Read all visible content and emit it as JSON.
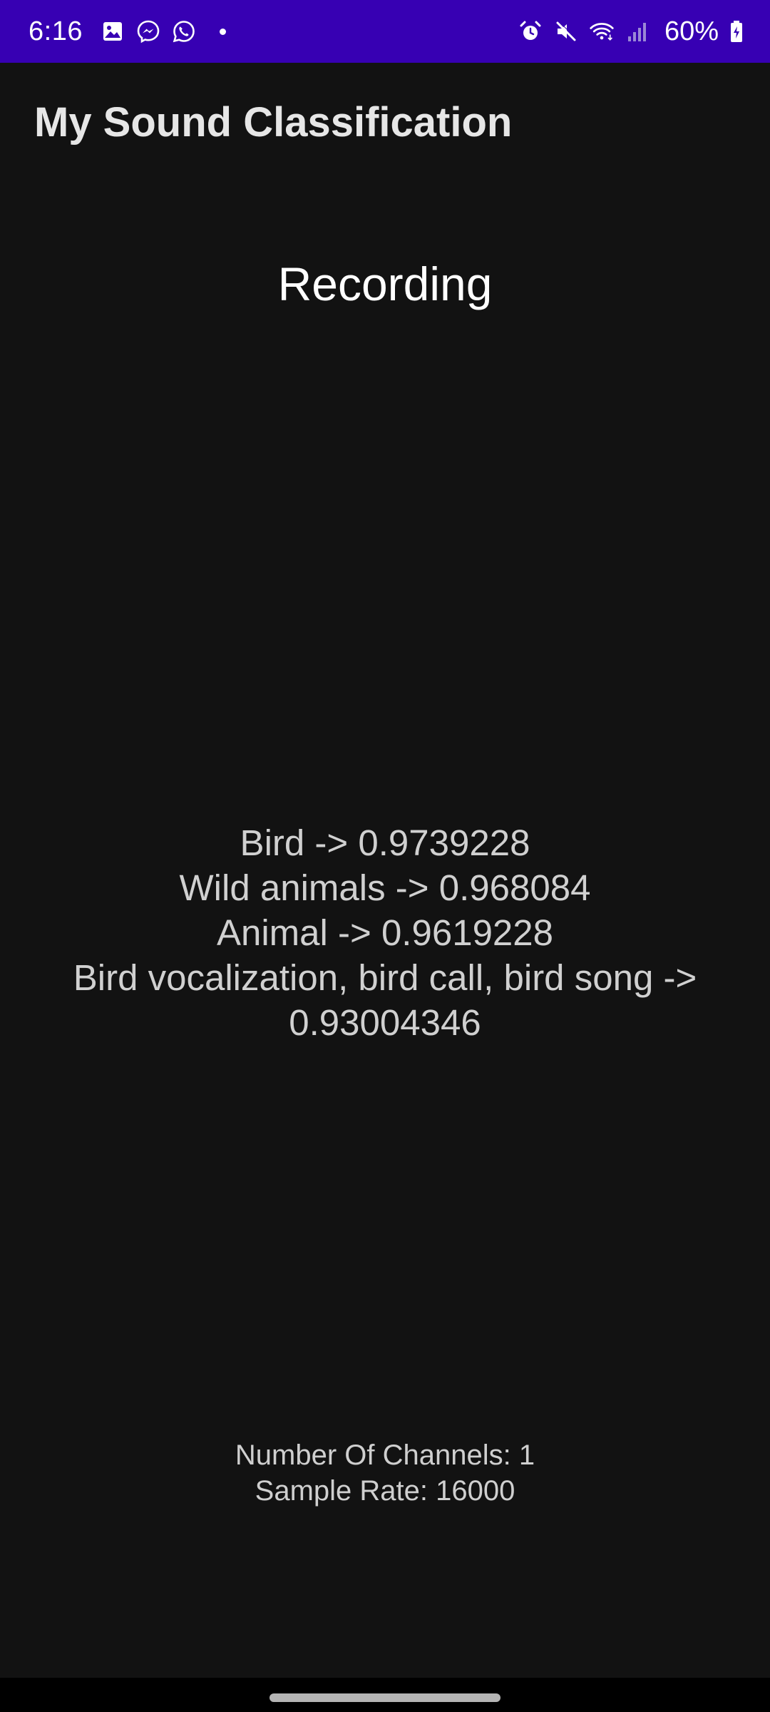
{
  "status_bar": {
    "time": "6:16",
    "left_icons": [
      "gallery-icon",
      "messenger-icon",
      "whatsapp-icon",
      "notification-dot-icon"
    ],
    "right_icons": [
      "alarm-icon",
      "mute-icon",
      "wifi-icon",
      "signal-icon",
      "battery-charging-icon"
    ],
    "battery": "60%",
    "background_color": "#3700b3"
  },
  "app_bar": {
    "title": "My Sound Classification"
  },
  "main": {
    "status": "Recording",
    "results": [
      "Bird -> 0.9739228",
      "Wild animals -> 0.968084",
      "Animal -> 0.9619228",
      "Bird vocalization, bird call, bird song ->",
      "0.93004346"
    ],
    "audio_info": {
      "channels": "Number Of Channels: 1",
      "sample_rate": "Sample Rate: 16000"
    }
  },
  "colors": {
    "background": "#121212",
    "status_bar": "#3700b3",
    "navigation_bar": "#000000"
  }
}
